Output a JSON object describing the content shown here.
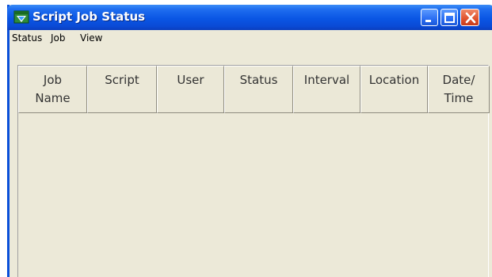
{
  "window": {
    "title": "Script Job Status",
    "icon": "app-icon",
    "buttons": {
      "minimize": "minimize-icon",
      "maximize": "maximize-icon",
      "close": "close-icon"
    }
  },
  "menubar": {
    "items": [
      {
        "label": "Status"
      },
      {
        "label": "Job"
      },
      {
        "label": "View"
      }
    ]
  },
  "table": {
    "columns": [
      {
        "label": "Job\nName"
      },
      {
        "label": "Script"
      },
      {
        "label": "User"
      },
      {
        "label": "Status"
      },
      {
        "label": "Interval"
      },
      {
        "label": "Location"
      },
      {
        "label": "Date/\nTime"
      }
    ],
    "rows": []
  },
  "colors": {
    "titlebar": "#0a56e4",
    "window_bg": "#ece9d8",
    "close_button": "#e0522d"
  }
}
